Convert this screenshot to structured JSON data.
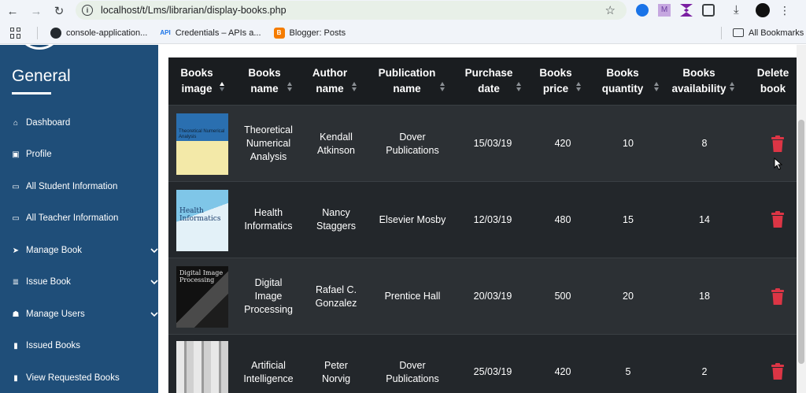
{
  "browser": {
    "url": "localhost/t/Lms/librarian/display-books.php",
    "bookmarks": [
      {
        "label": "console-application..."
      },
      {
        "label": "Credentials – APIs a...",
        "icon_text": "API"
      },
      {
        "label": "Blogger: Posts"
      }
    ],
    "all_bookmarks": "All Bookmarks"
  },
  "sidebar": {
    "title": "General",
    "items": [
      {
        "label": "Dashboard",
        "icon": "home-icon",
        "glyph": "⌂"
      },
      {
        "label": "Profile",
        "icon": "id-card-icon",
        "glyph": "▣"
      },
      {
        "label": "All Student Information",
        "icon": "monitor-icon",
        "glyph": "▭"
      },
      {
        "label": "All Teacher Information",
        "icon": "monitor-icon",
        "glyph": "▭"
      },
      {
        "label": "Manage Book",
        "icon": "paper-plane-icon",
        "glyph": "➤"
      },
      {
        "label": "Issue Book",
        "icon": "list-icon",
        "glyph": "≣"
      },
      {
        "label": "Manage Users",
        "icon": "users-icon",
        "glyph": "☗"
      },
      {
        "label": "Issued Books",
        "icon": "bookmark-icon",
        "glyph": "▮"
      },
      {
        "label": "View Requested Books",
        "icon": "book-icon",
        "glyph": "▮"
      }
    ]
  },
  "table": {
    "headers": [
      {
        "line1": "Books",
        "line2": "image"
      },
      {
        "line1": "Books",
        "line2": "name"
      },
      {
        "line1": "Author",
        "line2": "name"
      },
      {
        "line1": "Publication",
        "line2": "name"
      },
      {
        "line1": "Purchase",
        "line2": "date"
      },
      {
        "line1": "Books",
        "line2": "price"
      },
      {
        "line1": "Books",
        "line2": "quantity"
      },
      {
        "line1": "Books",
        "line2": "availability"
      },
      {
        "line1": "Delete",
        "line2": "book"
      }
    ],
    "rows": [
      {
        "name": [
          "Theoretical",
          "Numerical",
          "Analysis"
        ],
        "author": [
          "Kendall",
          "Atkinson"
        ],
        "publication": [
          "Dover",
          "Publications"
        ],
        "date": "15/03/19",
        "price": "420",
        "quantity": "10",
        "availability": "8",
        "cover_text": "Theoretical Numerical Analysis"
      },
      {
        "name": [
          "Health",
          "Informatics"
        ],
        "author": [
          "Nancy",
          "Staggers"
        ],
        "publication": [
          "Elsevier Mosby"
        ],
        "date": "12/03/19",
        "price": "480",
        "quantity": "15",
        "availability": "14",
        "cover_text": "Health Informatics"
      },
      {
        "name": [
          "Digital",
          "Image",
          "Processing"
        ],
        "author": [
          "Rafael C.",
          "Gonzalez"
        ],
        "publication": [
          "Prentice Hall"
        ],
        "date": "20/03/19",
        "price": "500",
        "quantity": "20",
        "availability": "18",
        "cover_text": "Digital Image Processing"
      },
      {
        "name": [
          "Artificial",
          "Intelligence"
        ],
        "author": [
          "Peter",
          "Norvig"
        ],
        "publication": [
          "Dover",
          "Publications"
        ],
        "date": "25/03/19",
        "price": "420",
        "quantity": "5",
        "availability": "2",
        "cover_text": ""
      }
    ]
  },
  "colors": {
    "sidebar_bg": "#1f4e79",
    "table_header_bg": "#1a1d20",
    "row_bg": "#2c3034",
    "row_alt_bg": "#23272b",
    "delete_red": "#dc3545"
  }
}
